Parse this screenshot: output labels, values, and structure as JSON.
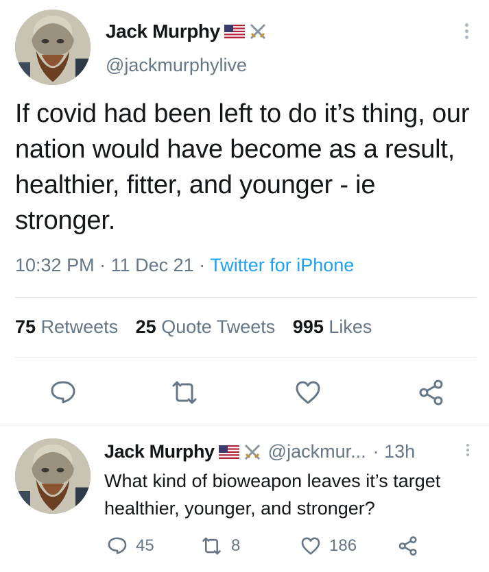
{
  "main_tweet": {
    "author_name": "Jack Murphy",
    "author_handle": "@jackmurphylive",
    "text": "If covid had been left to do it’s thing, our nation would have become as a result, healthier, fitter, and younger - ie stronger.",
    "time": "10:32 PM",
    "date": "11 Dec 21",
    "separator": "·",
    "source": "Twitter for iPhone",
    "stats": {
      "retweets_count": "75",
      "retweets_label": "Retweets",
      "quotes_count": "25",
      "quotes_label": "Quote Tweets",
      "likes_count": "995",
      "likes_label": "Likes"
    }
  },
  "reply_tweet": {
    "author_name": "Jack Murphy",
    "author_handle": "@jackmur...",
    "time_ago": "· 13h",
    "text": "What kind of bioweapon leaves it’s target healthier, younger, and stronger?",
    "reply_count": "45",
    "retweet_count": "8",
    "like_count": "186"
  },
  "icons": {
    "flag": "us-flag-icon",
    "swords": "crossed-swords-icon",
    "reply": "reply-icon",
    "retweet": "retweet-icon",
    "like": "heart-icon",
    "share": "share-icon",
    "more": "more-vertical-icon"
  },
  "colors": {
    "text": "#14171a",
    "secondary": "#657786",
    "link": "#1da1f2",
    "divider": "#e1e8ed"
  }
}
